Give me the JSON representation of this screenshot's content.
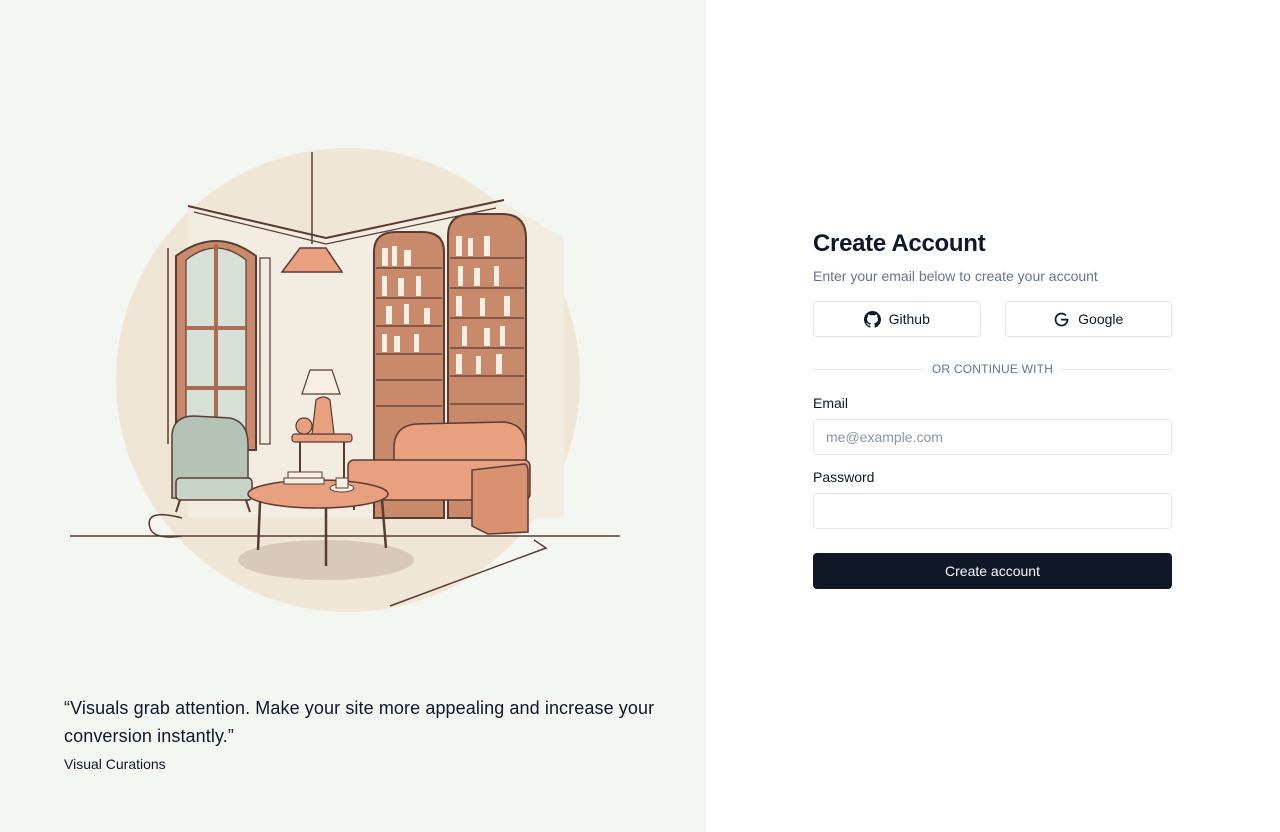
{
  "brand_panel": {
    "quote": "“Visuals grab attention. Make your site more appealing and increase your conversion instantly.”",
    "author": "Visual Curations"
  },
  "form": {
    "title": "Create Account",
    "subtitle": "Enter your email below to create your account",
    "oauth": {
      "github_label": "Github",
      "google_label": "Google"
    },
    "divider_text": "OR CONTINUE WITH",
    "email": {
      "label": "Email",
      "placeholder": "me@example.com",
      "value": ""
    },
    "password": {
      "label": "Password",
      "placeholder": "",
      "value": ""
    },
    "submit_label": "Create account"
  },
  "colors": {
    "left_background": "#f4f6f2",
    "primary_button": "#101827",
    "border": "#e2e8f0",
    "muted_text": "#64748b",
    "illustration_accent": "#e8a07f"
  }
}
